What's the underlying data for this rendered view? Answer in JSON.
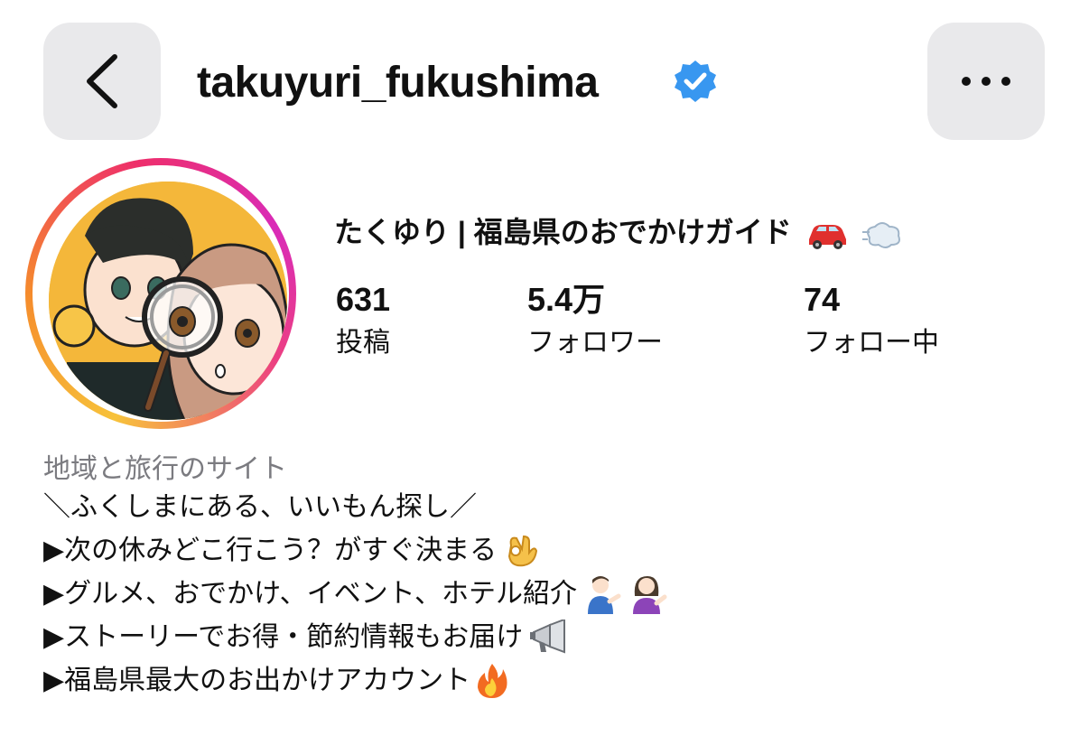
{
  "header": {
    "username": "takuyuri_fukushima",
    "verified": true,
    "back_icon": "chevron-left-icon",
    "more_icon": "ellipsis-icon"
  },
  "profile": {
    "display_name": "たくゆり | 福島県のおでかけガイド",
    "display_name_emojis": [
      "car-emoji",
      "dash-emoji"
    ],
    "stats": [
      {
        "value": "631",
        "label": "投稿"
      },
      {
        "value": "5.4万",
        "label": "フォロワー"
      },
      {
        "value": "74",
        "label": "フォロー中"
      }
    ]
  },
  "bio": {
    "category": "地域と旅行のサイト",
    "lines": [
      {
        "text": "＼ふくしまにある、いいもん探し／",
        "emoji": ""
      },
      {
        "text": "▶次の休みどこ行こう？がすぐ決まる",
        "emoji": "ok-hand-emoji"
      },
      {
        "text": "▶グルメ、おでかけ、イベント、ホテル紹介",
        "emoji": "tipping-hand-people-emoji"
      },
      {
        "text": "▶ストーリーでお得・節約情報もお届け",
        "emoji": "megaphone-emoji"
      },
      {
        "text": "▶福島県最大のお出かけアカウント",
        "emoji": "fire-emoji"
      }
    ]
  },
  "colors": {
    "verified_blue": "#3897f0",
    "button_bg": "#e9e9eb",
    "category_gray": "#7b7b80",
    "avatar_bg": "#f4b73a"
  }
}
